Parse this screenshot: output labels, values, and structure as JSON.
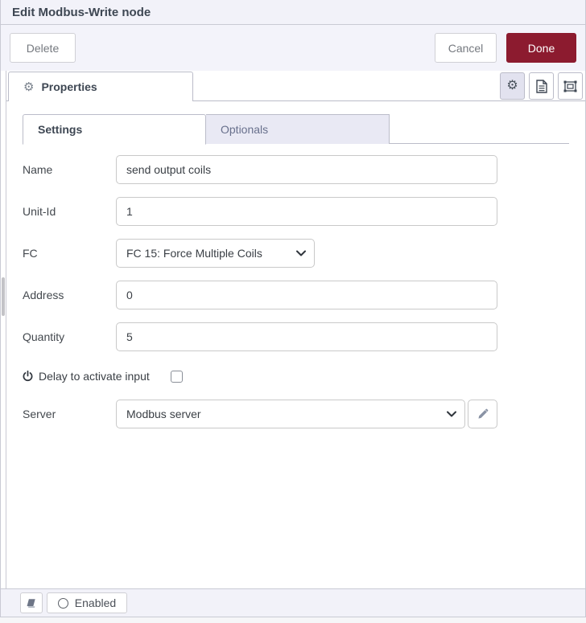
{
  "window": {
    "title": "Edit Modbus-Write node"
  },
  "toolbar": {
    "delete": "Delete",
    "cancel": "Cancel",
    "done": "Done"
  },
  "editor_tabs": {
    "properties": "Properties"
  },
  "tabs": {
    "settings": "Settings",
    "optionals": "Optionals"
  },
  "form": {
    "name": {
      "label": "Name",
      "value": "send output coils"
    },
    "unit_id": {
      "label": "Unit-Id",
      "value": "1"
    },
    "fc": {
      "label": "FC",
      "value": "FC 15: Force Multiple Coils"
    },
    "address": {
      "label": "Address",
      "value": "0"
    },
    "quantity": {
      "label": "Quantity",
      "value": "5"
    },
    "delay": {
      "label": "Delay to activate input",
      "checked": false
    },
    "server": {
      "label": "Server",
      "value": "Modbus server"
    }
  },
  "footer": {
    "enabled": "Enabled"
  },
  "icons": {
    "gear": "⚙",
    "properties_tab_icon": "gear-icon",
    "toolbar_icons": [
      "gear-icon",
      "document-icon",
      "object-group-icon"
    ],
    "delay_icon": "power-icon",
    "server_edit_icon": "pencil-icon",
    "footer_icons": [
      "book-icon",
      "circle-icon"
    ]
  },
  "colors": {
    "done_button_bg": "#8c1b2f",
    "header_bg": "#f2f2f9",
    "inactive_tab_bg": "#e9e9f4",
    "tab_border": "#bbbcc9",
    "frame_border": "#c9cad4"
  }
}
